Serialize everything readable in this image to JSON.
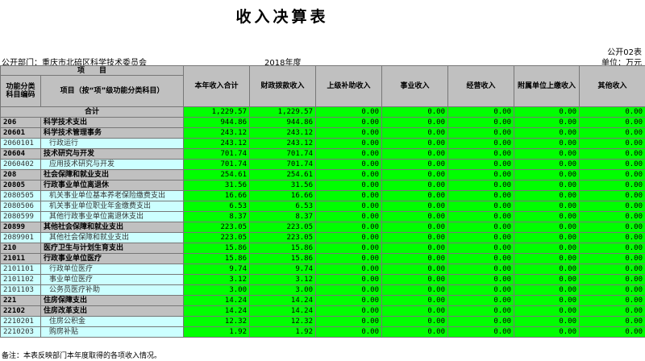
{
  "title": "收入决算表",
  "form_no": "公开02表",
  "department": "公开部门：重庆市北碚区科学技术委员会",
  "year": "2018年度",
  "unit": "单位：万元",
  "header": {
    "item_group": "项　　目",
    "code": "功能分类科目编码",
    "name": "项目（按“项”级功能分类科目）",
    "cols": [
      "本年收入合计",
      "财政拨款收入",
      "上级补助收入",
      "事业收入",
      "经营收入",
      "附属单位上缴收入",
      "其他收入"
    ]
  },
  "total": {
    "label": "合计",
    "values": [
      "1,229.57",
      "1,229.57",
      "0.00",
      "0.00",
      "0.00",
      "0.00",
      "0.00"
    ]
  },
  "rows": [
    {
      "level": 1,
      "code": "206",
      "name": "科学技术支出",
      "values": [
        "944.86",
        "944.86",
        "0.00",
        "0.00",
        "0.00",
        "0.00",
        "0.00"
      ]
    },
    {
      "level": 2,
      "code": "20601",
      "name": "科学技术管理事务",
      "values": [
        "243.12",
        "243.12",
        "0.00",
        "0.00",
        "0.00",
        "0.00",
        "0.00"
      ]
    },
    {
      "level": 3,
      "code": "2060101",
      "name": "行政运行",
      "values": [
        "243.12",
        "243.12",
        "0.00",
        "0.00",
        "0.00",
        "0.00",
        "0.00"
      ]
    },
    {
      "level": 2,
      "code": "20604",
      "name": "技术研究与开发",
      "values": [
        "701.74",
        "701.74",
        "0.00",
        "0.00",
        "0.00",
        "0.00",
        "0.00"
      ]
    },
    {
      "level": 3,
      "code": "2060402",
      "name": "应用技术研究与开发",
      "values": [
        "701.74",
        "701.74",
        "0.00",
        "0.00",
        "0.00",
        "0.00",
        "0.00"
      ]
    },
    {
      "level": 1,
      "code": "208",
      "name": "社会保障和就业支出",
      "values": [
        "254.61",
        "254.61",
        "0.00",
        "0.00",
        "0.00",
        "0.00",
        "0.00"
      ]
    },
    {
      "level": 2,
      "code": "20805",
      "name": "行政事业单位离退休",
      "values": [
        "31.56",
        "31.56",
        "0.00",
        "0.00",
        "0.00",
        "0.00",
        "0.00"
      ]
    },
    {
      "level": 3,
      "code": "2080505",
      "name": "机关事业单位基本养老保险缴费支出",
      "values": [
        "16.66",
        "16.66",
        "0.00",
        "0.00",
        "0.00",
        "0.00",
        "0.00"
      ]
    },
    {
      "level": 3,
      "code": "2080506",
      "name": "机关事业单位职业年金缴费支出",
      "values": [
        "6.53",
        "6.53",
        "0.00",
        "0.00",
        "0.00",
        "0.00",
        "0.00"
      ]
    },
    {
      "level": 3,
      "code": "2080599",
      "name": "其他行政事业单位离退休支出",
      "values": [
        "8.37",
        "8.37",
        "0.00",
        "0.00",
        "0.00",
        "0.00",
        "0.00"
      ]
    },
    {
      "level": 2,
      "code": "20899",
      "name": "其他社会保障和就业支出",
      "values": [
        "223.05",
        "223.05",
        "0.00",
        "0.00",
        "0.00",
        "0.00",
        "0.00"
      ]
    },
    {
      "level": 3,
      "code": "2089901",
      "name": "其他社会保障和就业支出",
      "values": [
        "223.05",
        "223.05",
        "0.00",
        "0.00",
        "0.00",
        "0.00",
        "0.00"
      ]
    },
    {
      "level": 1,
      "code": "210",
      "name": "医疗卫生与计划生育支出",
      "values": [
        "15.86",
        "15.86",
        "0.00",
        "0.00",
        "0.00",
        "0.00",
        "0.00"
      ]
    },
    {
      "level": 2,
      "code": "21011",
      "name": "行政事业单位医疗",
      "values": [
        "15.86",
        "15.86",
        "0.00",
        "0.00",
        "0.00",
        "0.00",
        "0.00"
      ]
    },
    {
      "level": 3,
      "code": "2101101",
      "name": "行政单位医疗",
      "values": [
        "9.74",
        "9.74",
        "0.00",
        "0.00",
        "0.00",
        "0.00",
        "0.00"
      ]
    },
    {
      "level": 3,
      "code": "2101102",
      "name": "事业单位医疗",
      "values": [
        "3.12",
        "3.12",
        "0.00",
        "0.00",
        "0.00",
        "0.00",
        "0.00"
      ]
    },
    {
      "level": 3,
      "code": "2101103",
      "name": "公务员医疗补助",
      "values": [
        "3.00",
        "3.00",
        "0.00",
        "0.00",
        "0.00",
        "0.00",
        "0.00"
      ]
    },
    {
      "level": 1,
      "code": "221",
      "name": "住房保障支出",
      "values": [
        "14.24",
        "14.24",
        "0.00",
        "0.00",
        "0.00",
        "0.00",
        "0.00"
      ]
    },
    {
      "level": 2,
      "code": "22102",
      "name": "住房改革支出",
      "values": [
        "14.24",
        "14.24",
        "0.00",
        "0.00",
        "0.00",
        "0.00",
        "0.00"
      ]
    },
    {
      "level": 3,
      "code": "2210201",
      "name": "住房公积金",
      "values": [
        "12.32",
        "12.32",
        "0.00",
        "0.00",
        "0.00",
        "0.00",
        "0.00"
      ]
    },
    {
      "level": 3,
      "code": "2210203",
      "name": "购房补贴",
      "values": [
        "1.92",
        "1.92",
        "0.00",
        "0.00",
        "0.00",
        "0.00",
        "0.00"
      ]
    }
  ],
  "note": "备注：本表反映部门本年度取得的各项收入情况。",
  "colors": {
    "header_gray": "#c0c0c0",
    "value_green": "#00ff00",
    "detail_cyan": "#ccffff"
  }
}
